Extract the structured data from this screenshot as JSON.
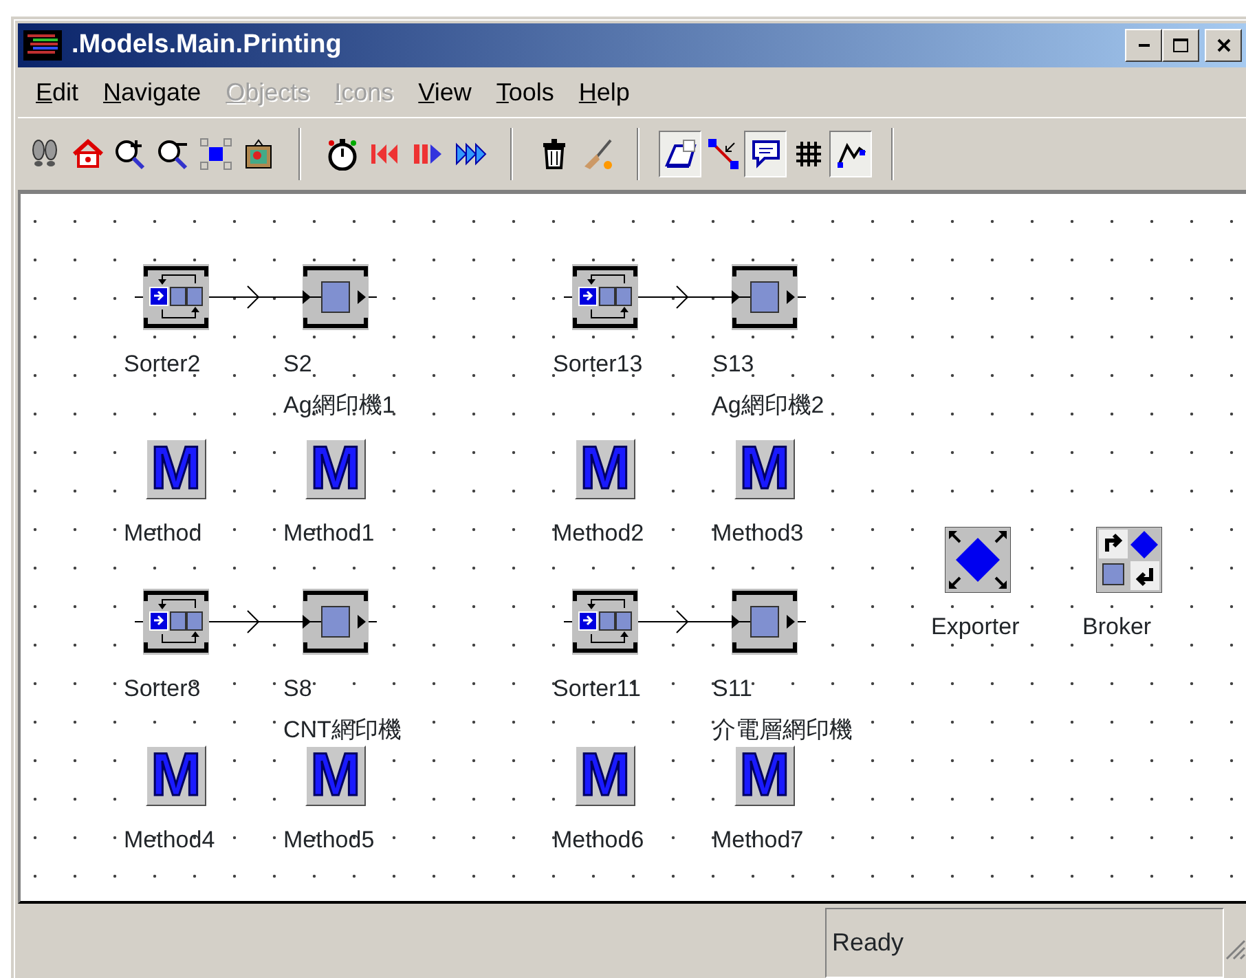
{
  "window": {
    "title": ".Models.Main.Printing"
  },
  "menu": [
    {
      "label": "Edit",
      "disabled": false
    },
    {
      "label": "Navigate",
      "disabled": false
    },
    {
      "label": "Objects",
      "disabled": true
    },
    {
      "label": "Icons",
      "disabled": true
    },
    {
      "label": "View",
      "disabled": false
    },
    {
      "label": "Tools",
      "disabled": false
    },
    {
      "label": "Help",
      "disabled": false
    }
  ],
  "toolbar": [
    {
      "kind": "footprints"
    },
    {
      "kind": "home"
    },
    {
      "kind": "zoom-in"
    },
    {
      "kind": "zoom-out"
    },
    {
      "kind": "fit"
    },
    {
      "kind": "frame"
    },
    {
      "kind": "separator"
    },
    {
      "kind": "stopwatch"
    },
    {
      "kind": "rewind"
    },
    {
      "kind": "step"
    },
    {
      "kind": "forward"
    },
    {
      "kind": "separator"
    },
    {
      "kind": "trash"
    },
    {
      "kind": "broom"
    },
    {
      "kind": "separator"
    },
    {
      "kind": "eraser",
      "pressed": true
    },
    {
      "kind": "connector",
      "pressed": false
    },
    {
      "kind": "bubble",
      "pressed": true
    },
    {
      "kind": "grid",
      "pressed": false
    },
    {
      "kind": "pen",
      "pressed": true
    },
    {
      "kind": "separator"
    }
  ],
  "nodes": [
    {
      "kind": "sorter",
      "label": "Sorter2"
    },
    {
      "kind": "station",
      "label": "S2",
      "sublabel": "Ag網印機1"
    },
    {
      "kind": "sorter",
      "label": "Sorter13"
    },
    {
      "kind": "station",
      "label": "S13",
      "sublabel": "Ag網印機2"
    },
    {
      "kind": "method",
      "glyph": "M",
      "label": "Method"
    },
    {
      "kind": "method",
      "glyph": "M",
      "label": "Method1"
    },
    {
      "kind": "method",
      "glyph": "M",
      "label": "Method2"
    },
    {
      "kind": "method",
      "glyph": "M",
      "label": "Method3"
    },
    {
      "kind": "exporter",
      "label": "Exporter"
    },
    {
      "kind": "broker",
      "label": "Broker"
    },
    {
      "kind": "sorter",
      "label": "Sorter8"
    },
    {
      "kind": "station",
      "label": "S8",
      "sublabel": "CNT網印機"
    },
    {
      "kind": "sorter",
      "label": "Sorter11"
    },
    {
      "kind": "station",
      "label": "S11",
      "sublabel": "介電層網印機"
    },
    {
      "kind": "method",
      "glyph": "M",
      "label": "Method4"
    },
    {
      "kind": "method",
      "glyph": "M",
      "label": "Method5"
    },
    {
      "kind": "method",
      "glyph": "M",
      "label": "Method6"
    },
    {
      "kind": "method",
      "glyph": "M",
      "label": "Method7"
    }
  ],
  "status_bar": {
    "text": "Ready"
  }
}
